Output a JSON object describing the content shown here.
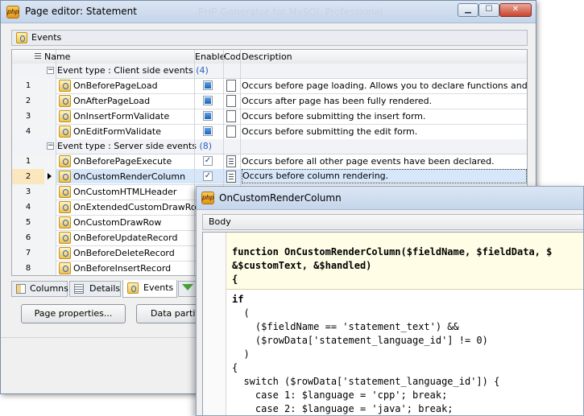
{
  "main_window": {
    "title": "Page editor: Statement",
    "title_watermark": "PHP Generator for MySQL Professional",
    "top_tab": "Events"
  },
  "grid": {
    "columns": [
      "Name",
      "Enable",
      "Cod",
      "Description"
    ],
    "groups": [
      {
        "label": "Event type : Client side events",
        "count": "(4)",
        "rows": [
          {
            "num": "1",
            "name": "OnBeforePageLoad",
            "enabled": true,
            "has_code": false,
            "description": "Occurs before page loading. Allows you to declare functions and global va"
          },
          {
            "num": "2",
            "name": "OnAfterPageLoad",
            "enabled": true,
            "has_code": false,
            "description": "Occurs after page has been fully rendered."
          },
          {
            "num": "3",
            "name": "OnInsertFormValidate",
            "enabled": true,
            "has_code": false,
            "description": "Occurs before submitting the insert form."
          },
          {
            "num": "4",
            "name": "OnEditFormValidate",
            "enabled": true,
            "has_code": false,
            "description": "Occurs before submitting the edit form."
          }
        ]
      },
      {
        "label": "Event type : Server side events",
        "count": "(8)",
        "rows": [
          {
            "num": "1",
            "name": "OnBeforePageExecute",
            "enabled": true,
            "has_code": true,
            "description": "Occurs before all other page events have been declared."
          },
          {
            "num": "2",
            "name": "OnCustomRenderColumn",
            "enabled": true,
            "has_code": true,
            "description": "Occurs before column rendering.",
            "selected": true
          },
          {
            "num": "3",
            "name": "OnCustomHTMLHeader",
            "enabled": false,
            "has_code": false,
            "description": ""
          },
          {
            "num": "4",
            "name": "OnExtendedCustomDrawRow",
            "enabled": false,
            "has_code": false,
            "description": ""
          },
          {
            "num": "5",
            "name": "OnCustomDrawRow",
            "enabled": false,
            "has_code": false,
            "description": ""
          },
          {
            "num": "6",
            "name": "OnBeforeUpdateRecord",
            "enabled": false,
            "has_code": false,
            "description": ""
          },
          {
            "num": "7",
            "name": "OnBeforeDeleteRecord",
            "enabled": false,
            "has_code": false,
            "description": ""
          },
          {
            "num": "8",
            "name": "OnBeforeInsertRecord",
            "enabled": false,
            "has_code": false,
            "description": ""
          }
        ]
      }
    ]
  },
  "bottom_tabs": [
    "Columns",
    "Details",
    "Events"
  ],
  "buttons": {
    "page_properties": "Page properties...",
    "data_partitioning": "Data partiti"
  },
  "code_window": {
    "title": "OnCustomRenderColumn",
    "tab": "Body",
    "lines": [
      {
        "text": "function OnCustomRenderColumn($fieldName, $fieldData, $",
        "kind": "func"
      },
      {
        "text": "&$customText, &$handled)",
        "kind": "func"
      },
      {
        "text": "{",
        "kind": "func"
      },
      {
        "text": "if",
        "kind": "body"
      },
      {
        "text": "  (",
        "kind": "body"
      },
      {
        "text": "    ($fieldName == 'statement_text') &&",
        "kind": "body"
      },
      {
        "text": "    ($rowData['statement_language_id'] != 0)",
        "kind": "body"
      },
      {
        "text": "  )",
        "kind": "body"
      },
      {
        "text": "{",
        "kind": "body"
      },
      {
        "text": "  switch ($rowData['statement_language_id']) {",
        "kind": "body"
      },
      {
        "text": "    case 1: $language = 'cpp'; break;",
        "kind": "body"
      },
      {
        "text": "    case 2: $language = 'java'; break;",
        "kind": "body"
      }
    ]
  },
  "icons": {
    "app": "php-icon",
    "window_controls": [
      "minimize-icon",
      "maximize-icon",
      "close-icon"
    ]
  },
  "colors": {
    "title_bar": "#c4d5ea",
    "selection": "#d6e7fa",
    "function_highlight": "#fffde6",
    "count_text": "#2a5dbd"
  }
}
